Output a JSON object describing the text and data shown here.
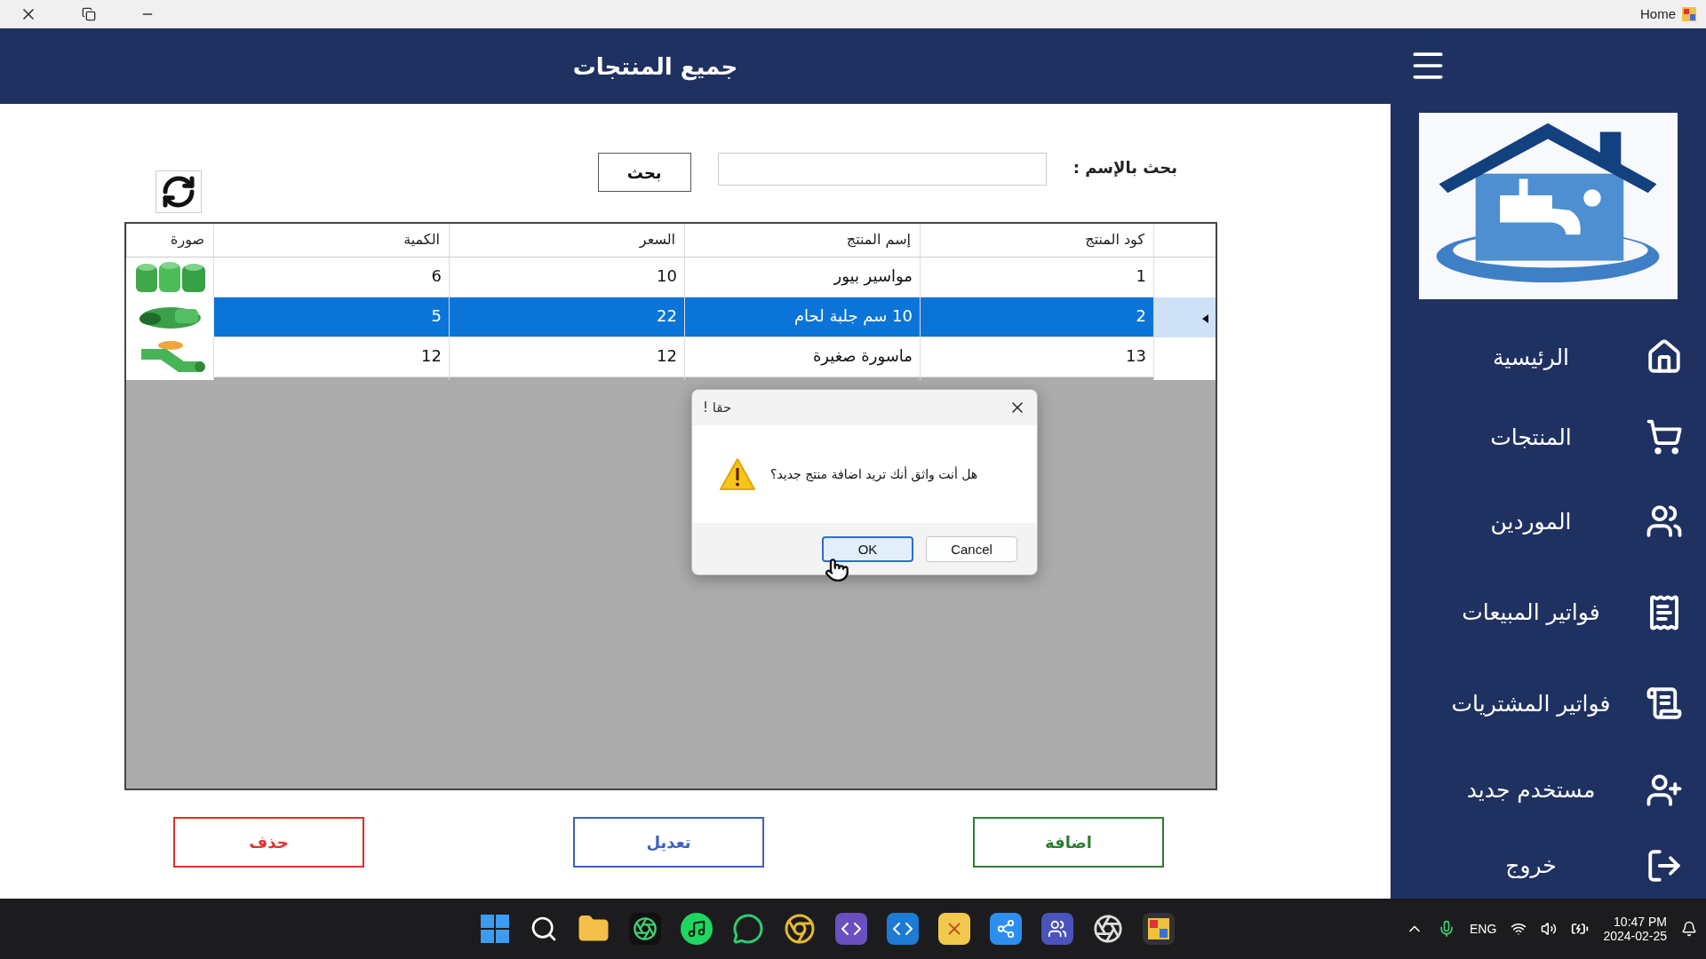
{
  "window": {
    "title": "Home"
  },
  "header": {
    "title": "جميع المنتجات"
  },
  "search": {
    "label": "بحث بالإسم :",
    "button": "بحث"
  },
  "table": {
    "columns": [
      "كود المنتج",
      "إسم المنتج",
      "السعر",
      "الكمية",
      "صورة"
    ],
    "rows": [
      {
        "code": "1",
        "name": "مواسير بيور",
        "price": "10",
        "qty": "6",
        "selected": false
      },
      {
        "code": "2",
        "name": "10 سم جلبة لحام",
        "price": "22",
        "qty": "5",
        "selected": true
      },
      {
        "code": "13",
        "name": "ماسورة صغيرة",
        "price": "12",
        "qty": "12",
        "selected": false
      }
    ]
  },
  "actions": [
    {
      "label": "اضافة",
      "kind": "add"
    },
    {
      "label": "تعديل",
      "kind": "edit"
    },
    {
      "label": "حذف",
      "kind": "delete"
    }
  ],
  "dialog": {
    "title": "! حقا",
    "message": "هل أنت واثق أنك تريد اضافة منتج جديد؟",
    "buttons": [
      {
        "label": "Cancel",
        "selected": false
      },
      {
        "label": "OK",
        "selected": true
      }
    ]
  },
  "sidebar": {
    "items": [
      "الرئيسية",
      "المنتجات",
      "الموردين",
      "فواتير المبيعات",
      "فواتير المشتريات",
      "مستخدم جديد",
      "خروج"
    ]
  },
  "taskbar": {
    "language": "ENG",
    "time": "10:47 PM",
    "date": "2024-02-25"
  }
}
